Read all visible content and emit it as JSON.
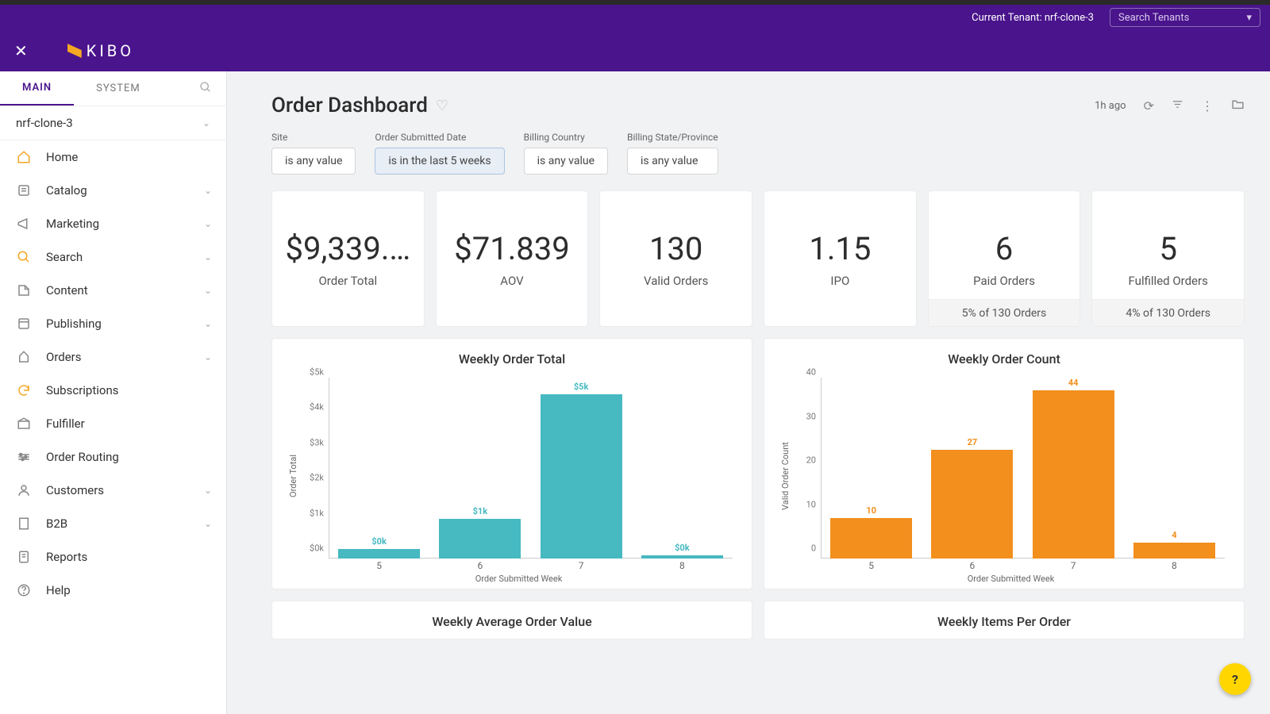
{
  "tenantbar": {
    "current": "Current Tenant: nrf-clone-3",
    "search_placeholder": "Search Tenants"
  },
  "logo": "KIBO",
  "navtabs": {
    "main": "MAIN",
    "system": "SYSTEM"
  },
  "tenant_row": "nrf-clone-3",
  "sidebar": [
    {
      "icon": "home",
      "label": "Home",
      "chev": false,
      "orange": true
    },
    {
      "icon": "catalog",
      "label": "Catalog",
      "chev": true
    },
    {
      "icon": "marketing",
      "label": "Marketing",
      "chev": true
    },
    {
      "icon": "search",
      "label": "Search",
      "chev": true,
      "orange": true
    },
    {
      "icon": "content",
      "label": "Content",
      "chev": true
    },
    {
      "icon": "publishing",
      "label": "Publishing",
      "chev": true
    },
    {
      "icon": "orders",
      "label": "Orders",
      "chev": true
    },
    {
      "icon": "subscriptions",
      "label": "Subscriptions",
      "chev": false,
      "orange": true
    },
    {
      "icon": "fulfiller",
      "label": "Fulfiller",
      "chev": false
    },
    {
      "icon": "routing",
      "label": "Order Routing",
      "chev": false
    },
    {
      "icon": "customers",
      "label": "Customers",
      "chev": true
    },
    {
      "icon": "b2b",
      "label": "B2B",
      "chev": true
    },
    {
      "icon": "reports",
      "label": "Reports",
      "chev": false
    },
    {
      "icon": "help",
      "label": "Help",
      "chev": false
    }
  ],
  "page": {
    "title": "Order Dashboard",
    "age": "1h ago"
  },
  "filters": [
    {
      "label": "Site",
      "value": "is any value",
      "active": false
    },
    {
      "label": "Order Submitted Date",
      "value": "is in the last 5 weeks",
      "active": true
    },
    {
      "label": "Billing Country",
      "value": "is any value",
      "active": false
    },
    {
      "label": "Billing State/Province",
      "value": "is any value",
      "active": false
    }
  ],
  "kpis": [
    {
      "value": "$9,339.…",
      "label": "Order Total"
    },
    {
      "value": "$71.839",
      "label": "AOV"
    },
    {
      "value": "130",
      "label": "Valid Orders"
    },
    {
      "value": "1.15",
      "label": "IPO"
    },
    {
      "value": "6",
      "label": "Paid Orders",
      "footer": "5% of 130 Orders"
    },
    {
      "value": "5",
      "label": "Fulfilled Orders",
      "footer": "4% of 130 Orders"
    }
  ],
  "chart_data": [
    {
      "type": "bar",
      "title": "Weekly Order Total",
      "xlabel": "Order Submitted Week",
      "ylabel": "Order Total",
      "categories": [
        "5",
        "6",
        "7",
        "8"
      ],
      "values": [
        300,
        1200,
        5000,
        100
      ],
      "value_labels": [
        "$0k",
        "$1k",
        "$5k",
        "$0k"
      ],
      "yticks": [
        "$0k",
        "$1k",
        "$2k",
        "$3k",
        "$4k",
        "$5k"
      ],
      "ylim": [
        0,
        5500
      ],
      "color": "teal"
    },
    {
      "type": "bar",
      "title": "Weekly Order Count",
      "xlabel": "Order Submitted Week",
      "ylabel": "Valid Order Count",
      "categories": [
        "5",
        "6",
        "7",
        "8"
      ],
      "values": [
        10,
        27,
        44,
        4
      ],
      "value_labels": [
        "10",
        "27",
        "44",
        "4"
      ],
      "yticks": [
        "0",
        "10",
        "20",
        "30",
        "40"
      ],
      "ylim": [
        0,
        45
      ],
      "color": "orange"
    }
  ],
  "lower_charts": [
    "Weekly Average Order Value",
    "Weekly Items Per Order"
  ],
  "help": "?"
}
